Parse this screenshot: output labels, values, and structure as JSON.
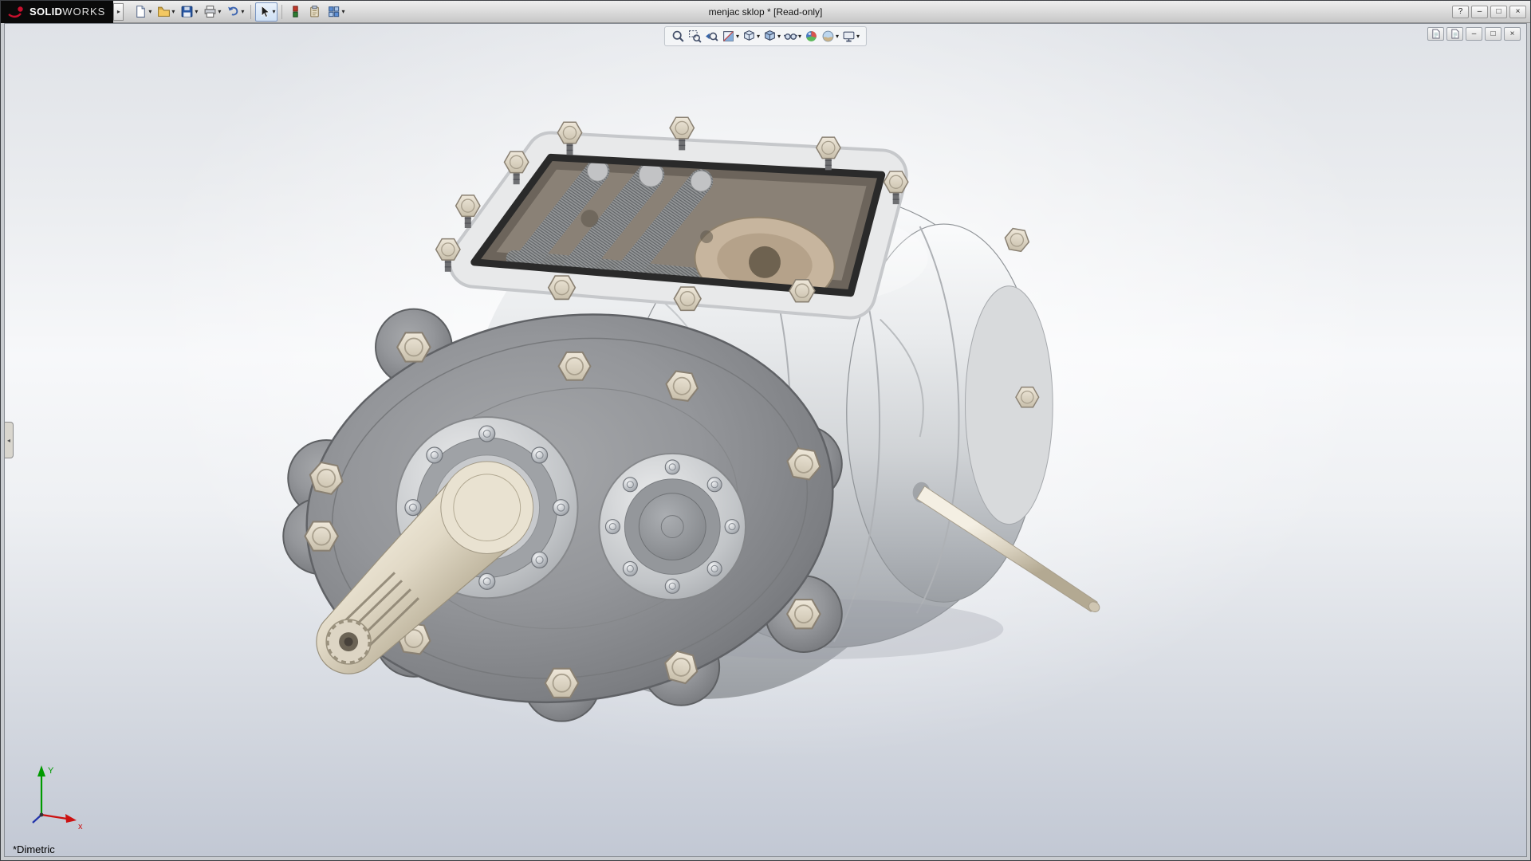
{
  "colors": {
    "brand_red": "#c8102e",
    "titlebar_bottom": "#c7c7c7",
    "viewport_top": "#e0e3e8",
    "viewport_bottom": "#c2c8d4",
    "active_tool_border": "#7a96c2",
    "triad_x_color": "#cc1111",
    "triad_y_color": "#009a00"
  },
  "glyphs": {
    "caret": "▾",
    "collapse": "◂",
    "expand": "▸"
  },
  "window": {
    "brand_bold": "SOLID",
    "brand_light": "WORKS",
    "title": "menjac sklop * [Read-only]",
    "controls": {
      "help": "?",
      "minimize": "–",
      "maximize": "□",
      "close": "×"
    }
  },
  "main_toolbar": {
    "items": [
      {
        "icon": "new-document-icon",
        "dropdown": true
      },
      {
        "icon": "open-folder-icon",
        "dropdown": true
      },
      {
        "icon": "save-icon",
        "dropdown": true
      },
      {
        "icon": "print-icon",
        "dropdown": true
      },
      {
        "icon": "undo-icon",
        "dropdown": true
      },
      {
        "icon": "select-arrow-icon",
        "dropdown": true,
        "active": true
      },
      {
        "icon": "red-green-stack-icon",
        "dropdown": false
      },
      {
        "icon": "clipboard-icon",
        "dropdown": false
      },
      {
        "icon": "grid-options-icon",
        "dropdown": true
      }
    ]
  },
  "headsup_toolbar": {
    "items": [
      {
        "icon": "zoom-to-fit-icon",
        "dropdown": false
      },
      {
        "icon": "zoom-to-area-icon",
        "dropdown": false
      },
      {
        "icon": "previous-view-icon",
        "dropdown": false
      },
      {
        "icon": "section-view-icon",
        "dropdown": true
      },
      {
        "icon": "view-orientation-icon",
        "dropdown": true
      },
      {
        "icon": "display-style-icon",
        "dropdown": true
      },
      {
        "icon": "hide-show-items-icon",
        "dropdown": true
      },
      {
        "icon": "edit-appearance-icon",
        "dropdown": false
      },
      {
        "icon": "apply-scene-icon",
        "dropdown": true
      },
      {
        "icon": "view-settings-icon",
        "dropdown": true
      }
    ]
  },
  "mdi_controls": {
    "minimize": "–",
    "restore": "□",
    "close": "×"
  },
  "viewport": {
    "view_label": "*Dimetric",
    "triad_x": "x",
    "triad_y": "Y"
  }
}
